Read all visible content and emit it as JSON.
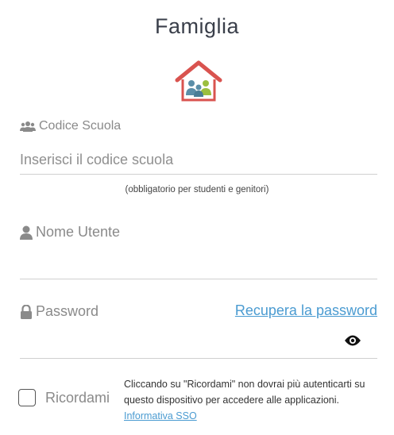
{
  "header": {
    "title": "Famiglia"
  },
  "logo": {
    "icon": "family-house-logo"
  },
  "school_code": {
    "label": "Codice Scuola",
    "placeholder": "Inserisci il codice scuola",
    "value": "",
    "hint": "(obbligatorio per studenti e genitori)"
  },
  "username": {
    "label": "Nome Utente",
    "value": ""
  },
  "password": {
    "label": "Password",
    "value": "",
    "recover_link": "Recupera la password"
  },
  "remember": {
    "label": "Ricordami",
    "checked": false,
    "note": "Cliccando su \"Ricordami\" non dovrai più autenticarti su questo dispositivo per accedere alle applicazioni.",
    "sso_link": "Informativa SSO"
  },
  "colors": {
    "link": "#4a9bd1",
    "title": "#3a3f4a",
    "roof": "#d9534f"
  }
}
